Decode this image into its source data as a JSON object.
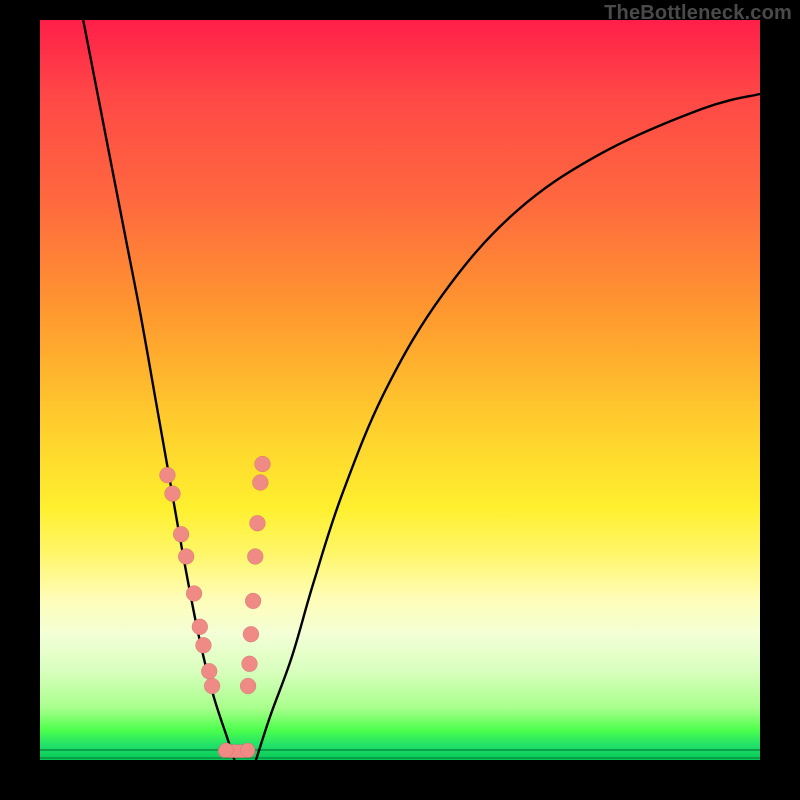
{
  "watermark": "TheBottleneck.com",
  "chart_data": {
    "type": "line",
    "title": "",
    "xlabel": "",
    "ylabel": "",
    "xlim": [
      0,
      100
    ],
    "ylim": [
      0,
      100
    ],
    "grid": false,
    "legend": false,
    "series": [
      {
        "name": "left-curve",
        "x": [
          6,
          8,
          10,
          12,
          14,
          16,
          18,
          20,
          22,
          24,
          26,
          27
        ],
        "y": [
          100,
          90,
          80,
          70,
          60,
          49,
          38,
          27,
          17,
          9,
          3,
          0
        ]
      },
      {
        "name": "right-curve",
        "x": [
          30,
          32,
          35,
          38,
          42,
          48,
          56,
          66,
          78,
          92,
          100
        ],
        "y": [
          0,
          6,
          14,
          24,
          36,
          50,
          63,
          74,
          82,
          88,
          90
        ]
      }
    ],
    "markers": {
      "left_branch": [
        {
          "x": 17.7,
          "y": 38.5
        },
        {
          "x": 18.4,
          "y": 36.0
        },
        {
          "x": 19.6,
          "y": 30.5
        },
        {
          "x": 20.3,
          "y": 27.5
        },
        {
          "x": 21.4,
          "y": 22.5
        },
        {
          "x": 22.2,
          "y": 18.0
        },
        {
          "x": 22.7,
          "y": 15.5
        },
        {
          "x": 23.5,
          "y": 12.0
        },
        {
          "x": 23.9,
          "y": 10.0
        }
      ],
      "right_branch": [
        {
          "x": 30.9,
          "y": 40.0
        },
        {
          "x": 30.6,
          "y": 37.5
        },
        {
          "x": 30.2,
          "y": 32.0
        },
        {
          "x": 29.9,
          "y": 27.5
        },
        {
          "x": 29.6,
          "y": 21.5
        },
        {
          "x": 29.3,
          "y": 17.0
        },
        {
          "x": 29.1,
          "y": 13.0
        },
        {
          "x": 28.9,
          "y": 10.0
        }
      ],
      "bottom_cluster": {
        "x": 27.3,
        "y": 1.2,
        "width": 5.2,
        "height": 1.8
      }
    },
    "colors": {
      "curve": "#000000",
      "marker": "#f08a85",
      "gradient_top": "#ff1f49",
      "gradient_mid": "#fff02f",
      "gradient_bottom": "#06c955",
      "background": "#000000"
    }
  }
}
